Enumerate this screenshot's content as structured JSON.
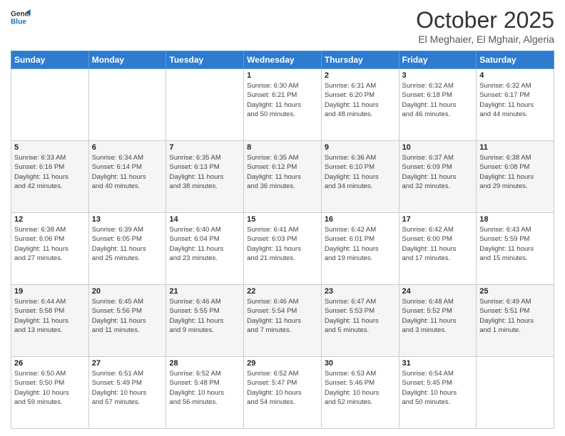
{
  "header": {
    "logo_line1": "General",
    "logo_line2": "Blue",
    "month": "October 2025",
    "location": "El Meghaier, El Mghair, Algeria"
  },
  "weekdays": [
    "Sunday",
    "Monday",
    "Tuesday",
    "Wednesday",
    "Thursday",
    "Friday",
    "Saturday"
  ],
  "weeks": [
    [
      {
        "day": "",
        "info": ""
      },
      {
        "day": "",
        "info": ""
      },
      {
        "day": "",
        "info": ""
      },
      {
        "day": "1",
        "info": "Sunrise: 6:30 AM\nSunset: 6:21 PM\nDaylight: 11 hours\nand 50 minutes."
      },
      {
        "day": "2",
        "info": "Sunrise: 6:31 AM\nSunset: 6:20 PM\nDaylight: 11 hours\nand 48 minutes."
      },
      {
        "day": "3",
        "info": "Sunrise: 6:32 AM\nSunset: 6:18 PM\nDaylight: 11 hours\nand 46 minutes."
      },
      {
        "day": "4",
        "info": "Sunrise: 6:32 AM\nSunset: 6:17 PM\nDaylight: 11 hours\nand 44 minutes."
      }
    ],
    [
      {
        "day": "5",
        "info": "Sunrise: 6:33 AM\nSunset: 6:16 PM\nDaylight: 11 hours\nand 42 minutes."
      },
      {
        "day": "6",
        "info": "Sunrise: 6:34 AM\nSunset: 6:14 PM\nDaylight: 11 hours\nand 40 minutes."
      },
      {
        "day": "7",
        "info": "Sunrise: 6:35 AM\nSunset: 6:13 PM\nDaylight: 11 hours\nand 38 minutes."
      },
      {
        "day": "8",
        "info": "Sunrise: 6:35 AM\nSunset: 6:12 PM\nDaylight: 11 hours\nand 36 minutes."
      },
      {
        "day": "9",
        "info": "Sunrise: 6:36 AM\nSunset: 6:10 PM\nDaylight: 11 hours\nand 34 minutes."
      },
      {
        "day": "10",
        "info": "Sunrise: 6:37 AM\nSunset: 6:09 PM\nDaylight: 11 hours\nand 32 minutes."
      },
      {
        "day": "11",
        "info": "Sunrise: 6:38 AM\nSunset: 6:08 PM\nDaylight: 11 hours\nand 29 minutes."
      }
    ],
    [
      {
        "day": "12",
        "info": "Sunrise: 6:38 AM\nSunset: 6:06 PM\nDaylight: 11 hours\nand 27 minutes."
      },
      {
        "day": "13",
        "info": "Sunrise: 6:39 AM\nSunset: 6:05 PM\nDaylight: 11 hours\nand 25 minutes."
      },
      {
        "day": "14",
        "info": "Sunrise: 6:40 AM\nSunset: 6:04 PM\nDaylight: 11 hours\nand 23 minutes."
      },
      {
        "day": "15",
        "info": "Sunrise: 6:41 AM\nSunset: 6:03 PM\nDaylight: 11 hours\nand 21 minutes."
      },
      {
        "day": "16",
        "info": "Sunrise: 6:42 AM\nSunset: 6:01 PM\nDaylight: 11 hours\nand 19 minutes."
      },
      {
        "day": "17",
        "info": "Sunrise: 6:42 AM\nSunset: 6:00 PM\nDaylight: 11 hours\nand 17 minutes."
      },
      {
        "day": "18",
        "info": "Sunrise: 6:43 AM\nSunset: 5:59 PM\nDaylight: 11 hours\nand 15 minutes."
      }
    ],
    [
      {
        "day": "19",
        "info": "Sunrise: 6:44 AM\nSunset: 5:58 PM\nDaylight: 11 hours\nand 13 minutes."
      },
      {
        "day": "20",
        "info": "Sunrise: 6:45 AM\nSunset: 5:56 PM\nDaylight: 11 hours\nand 11 minutes."
      },
      {
        "day": "21",
        "info": "Sunrise: 6:46 AM\nSunset: 5:55 PM\nDaylight: 11 hours\nand 9 minutes."
      },
      {
        "day": "22",
        "info": "Sunrise: 6:46 AM\nSunset: 5:54 PM\nDaylight: 11 hours\nand 7 minutes."
      },
      {
        "day": "23",
        "info": "Sunrise: 6:47 AM\nSunset: 5:53 PM\nDaylight: 11 hours\nand 5 minutes."
      },
      {
        "day": "24",
        "info": "Sunrise: 6:48 AM\nSunset: 5:52 PM\nDaylight: 11 hours\nand 3 minutes."
      },
      {
        "day": "25",
        "info": "Sunrise: 6:49 AM\nSunset: 5:51 PM\nDaylight: 11 hours\nand 1 minute."
      }
    ],
    [
      {
        "day": "26",
        "info": "Sunrise: 6:50 AM\nSunset: 5:50 PM\nDaylight: 10 hours\nand 59 minutes."
      },
      {
        "day": "27",
        "info": "Sunrise: 6:51 AM\nSunset: 5:49 PM\nDaylight: 10 hours\nand 57 minutes."
      },
      {
        "day": "28",
        "info": "Sunrise: 6:52 AM\nSunset: 5:48 PM\nDaylight: 10 hours\nand 56 minutes."
      },
      {
        "day": "29",
        "info": "Sunrise: 6:52 AM\nSunset: 5:47 PM\nDaylight: 10 hours\nand 54 minutes."
      },
      {
        "day": "30",
        "info": "Sunrise: 6:53 AM\nSunset: 5:46 PM\nDaylight: 10 hours\nand 52 minutes."
      },
      {
        "day": "31",
        "info": "Sunrise: 6:54 AM\nSunset: 5:45 PM\nDaylight: 10 hours\nand 50 minutes."
      },
      {
        "day": "",
        "info": ""
      }
    ]
  ]
}
